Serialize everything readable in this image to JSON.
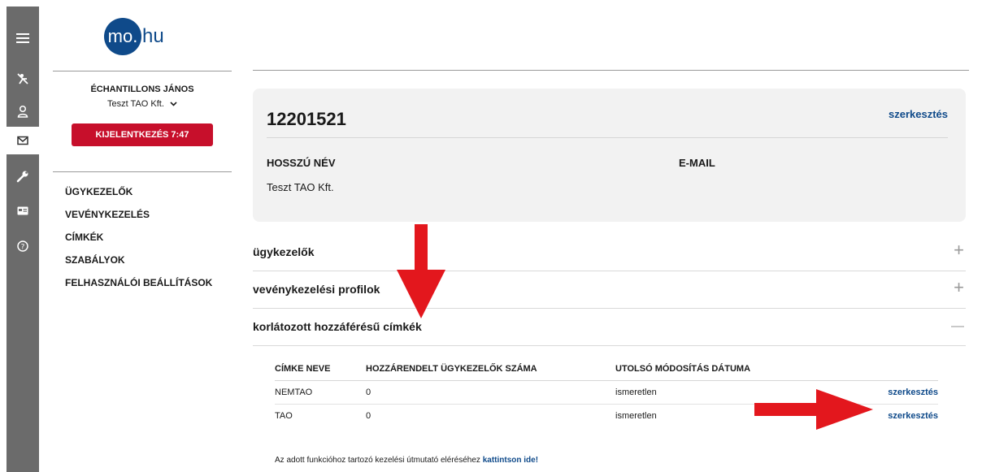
{
  "logo": {
    "mark": "mo.",
    "rest": "hu"
  },
  "user": {
    "name": "ÉCHANTILLONS JÁNOS",
    "company": "Teszt TAO Kft."
  },
  "logout_label": "KIJELENTKEZÉS 7:47",
  "nav": [
    "ÜGYKEZELŐK",
    "VEVÉNYKEZELÉS",
    "CÍMKÉK",
    "SZABÁLYOK",
    "FELHASZNÁLÓI BEÁLLÍTÁSOK"
  ],
  "rail_icons": [
    "menu-icon",
    "no-entry-icon",
    "user-icon",
    "mail-icon",
    "wrench-icon",
    "card-icon",
    "help-icon"
  ],
  "card": {
    "id": "12201521",
    "edit": "szerkesztés",
    "label_name": "HOSSZÚ NÉV",
    "label_email": "E-MAIL",
    "value_name": "Teszt TAO Kft."
  },
  "accordions": [
    {
      "title": "ügykezelők",
      "icon": "+"
    },
    {
      "title": "vevénykezelési profilok",
      "icon": "+"
    },
    {
      "title": "korlátozott hozzáférésű címkék",
      "icon": "—"
    }
  ],
  "table": {
    "headers": [
      "CÍMKE NEVE",
      "HOZZÁRENDELT ÜGYKEZELŐK SZÁMA",
      "UTOLSÓ MÓDOSÍTÁS DÁTUMA"
    ],
    "rows": [
      {
        "name": "NEMTAO",
        "count": "0",
        "date": "ismeretlen",
        "action": "szerkesztés"
      },
      {
        "name": "TAO",
        "count": "0",
        "date": "ismeretlen",
        "action": "szerkesztés"
      }
    ]
  },
  "footer": {
    "text": "Az adott funkcióhoz tartozó kezelési útmutató eléréséhez ",
    "link": "kattintson ide!"
  },
  "colors": {
    "brand": "#0f4a8a",
    "logout": "#c70f2b",
    "arrow": "#e3171d",
    "rail": "#6b6b6b"
  }
}
